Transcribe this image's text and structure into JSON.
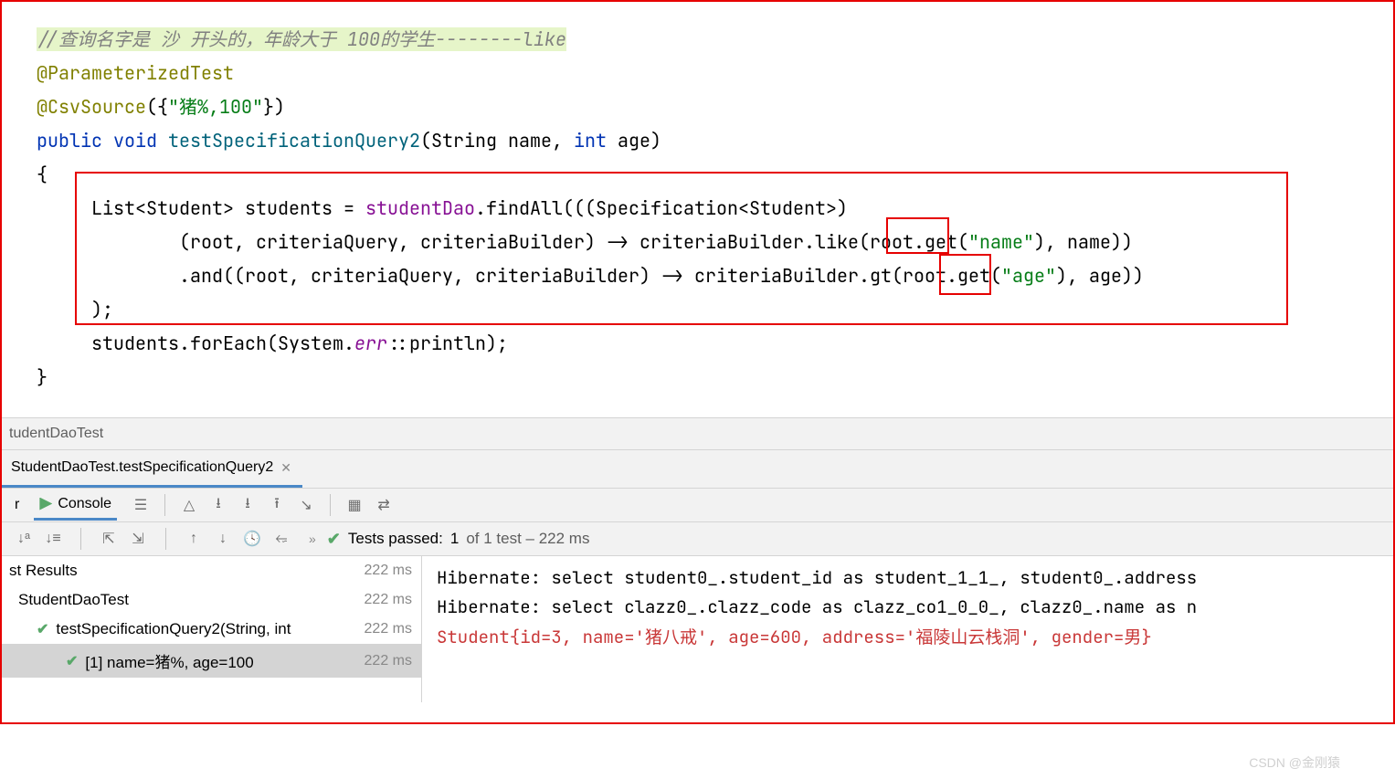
{
  "code": {
    "comment_text": "//查询名字是 沙 开头的，年龄大于 100的学生--------like",
    "annotation1": "@ParameterizedTest",
    "annotation2": "@CsvSource",
    "csv_value": "\"猪%,100\"",
    "kw_public": "public",
    "kw_void": "void",
    "method_name": "testSpecificationQuery2",
    "param_type1": "String",
    "param_name1": "name",
    "param_type2": "int",
    "param_name2": "age",
    "list_type": "List",
    "student_type": "Student",
    "students_var": "students",
    "student_dao": "studentDao",
    "find_all": "findAll",
    "specification": "Specification",
    "root": "root",
    "criteria_query": "criteriaQuery",
    "criteria_builder": "criteriaBuilder",
    "like": "like",
    "get": "get",
    "name_str": "\"name\"",
    "name_var": "name",
    "and": "and",
    "gt": "gt",
    "age_str": "\"age\"",
    "age_var": "age",
    "for_each": "forEach",
    "system": "System",
    "err_field": "err",
    "println": "println"
  },
  "breadcrumb": {
    "text": "tudentDaoTest"
  },
  "tab": {
    "label": "StudentDaoTest.testSpecificationQuery2"
  },
  "toolbar": {
    "console_label": "Console",
    "left_label": "r"
  },
  "test_status": {
    "prefix": "Tests passed:",
    "count": "1",
    "suffix": "of 1 test – 222 ms"
  },
  "test_tree": {
    "root": {
      "label": "st Results",
      "time": "222 ms"
    },
    "class": {
      "label": "StudentDaoTest",
      "time": "222 ms"
    },
    "method": {
      "label": "testSpecificationQuery2(String, int",
      "time": "222 ms"
    },
    "case": {
      "label": "[1] name=猪%, age=100",
      "time": "222 ms"
    }
  },
  "console_output": {
    "line1": "Hibernate: select student0_.student_id as student_1_1_, student0_.address",
    "line2": "Hibernate: select clazz0_.clazz_code as clazz_co1_0_0_, clazz0_.name as n",
    "line3": "Student{id=3, name='猪八戒', age=600, address='福陵山云栈洞', gender=男}"
  },
  "watermark": "CSDN @金刚猿"
}
